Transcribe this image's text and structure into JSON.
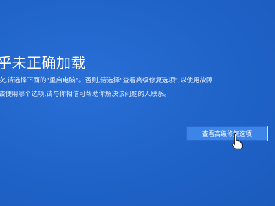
{
  "dialog": {
    "title": "乎未正确加载",
    "lines": [
      "次,请选择下面的\"重启电脑\"。否则,请选择\"查看高级修复选项\",以使用故障",
      "该使用哪个选项,请与你相信可帮助你解决该问题的人联系。"
    ],
    "advanced_options_label": "查看高级修复选项"
  },
  "colors": {
    "background": "#1f63c8",
    "button_fill": "#3c84e8",
    "text": "#ffffff"
  },
  "icons": {
    "cursor": "hand-pointer-icon"
  }
}
